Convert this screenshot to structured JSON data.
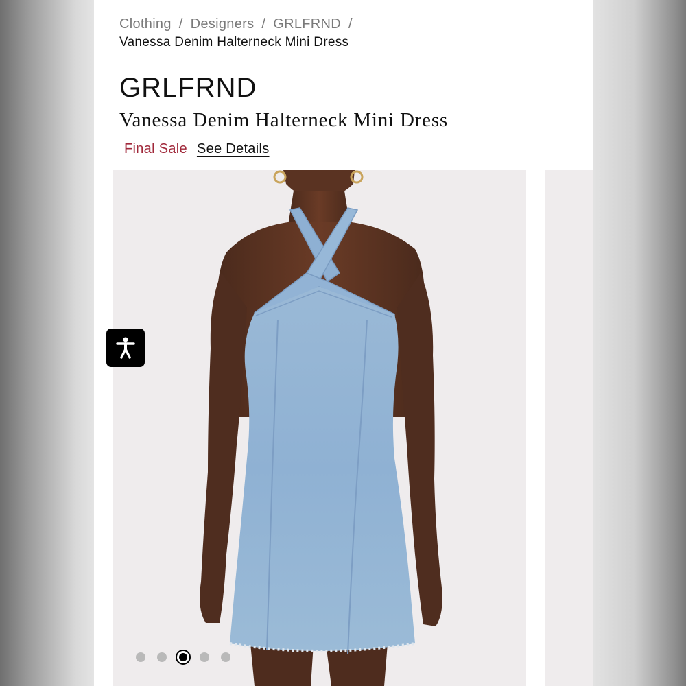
{
  "breadcrumb": {
    "items": [
      "Clothing",
      "Designers",
      "GRLFRND"
    ],
    "separator": "/",
    "current": "Vanessa Denim Halterneck Mini Dress"
  },
  "product": {
    "brand": "GRLFRND",
    "name": "Vanessa Denim Halterneck Mini Dress",
    "sale_label": "Final Sale",
    "details_link": "See Details"
  },
  "gallery": {
    "image_count": 5,
    "active_index": 3
  },
  "accessibility_button": {
    "icon": "accessibility-icon"
  },
  "colors": {
    "sale_red": "#a0283a",
    "denim": "#8fb0d2",
    "background": "#efeced"
  }
}
